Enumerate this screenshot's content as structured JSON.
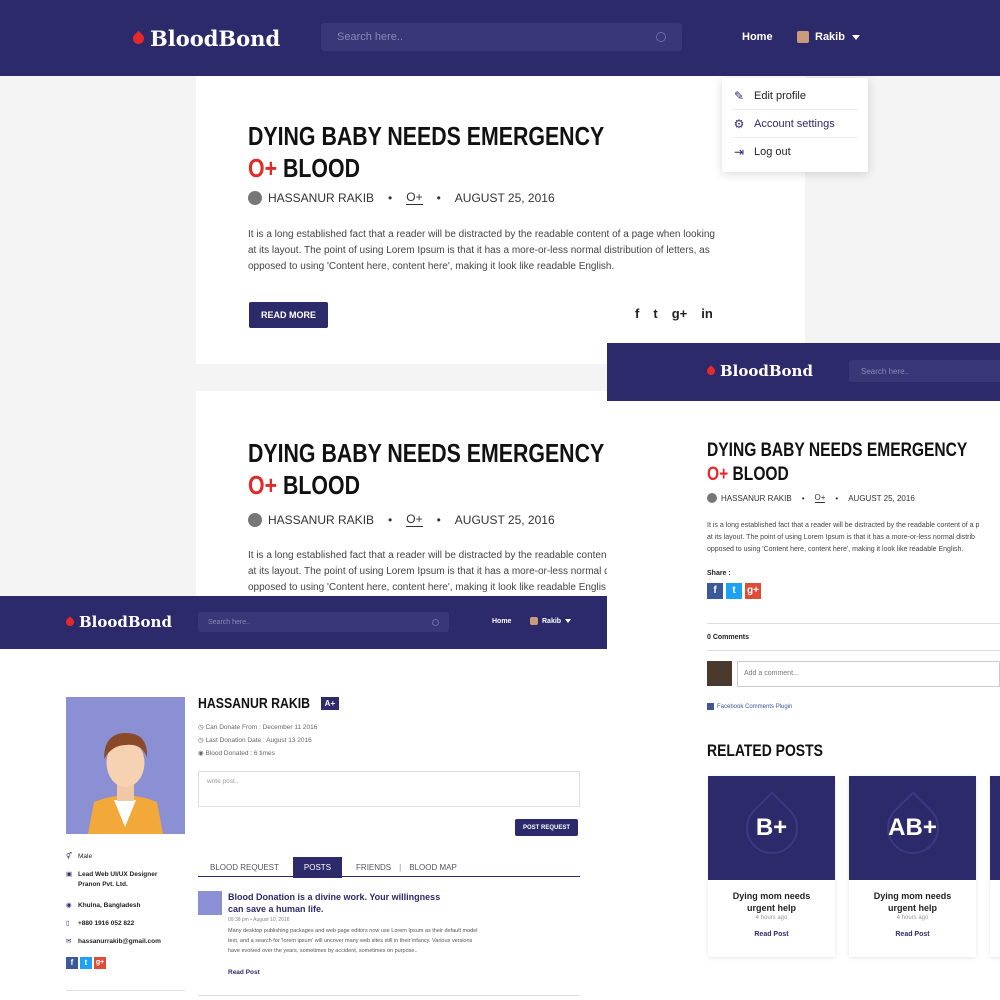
{
  "brand": {
    "name": "BloodBond"
  },
  "search": {
    "placeholder": "Search here.."
  },
  "nav": {
    "home": "Home",
    "user": "Rakib"
  },
  "dropdown": {
    "items": [
      {
        "label": "Edit profile",
        "icon": "edit-user-icon"
      },
      {
        "label": "Account settings",
        "icon": "settings-icon"
      },
      {
        "label": "Log out",
        "icon": "logout-icon"
      }
    ]
  },
  "post": {
    "title_line1": "DYING BABY NEEDS EMERGENCY",
    "blood_group": "O+",
    "title_line2_suffix": "BLOOD",
    "author": "HASSANUR RAKIB",
    "group_meta": "O+",
    "date": "AUGUST 25, 2016",
    "body": "It is a long established fact that a reader will be distracted by the readable content of a page when looking at its layout. The point of using Lorem Ipsum is that it has a more-or-less normal distribution of letters, as opposed to using 'Content here, content here', making it look like readable English.",
    "read_more": "READ MORE",
    "social": [
      "f",
      "t",
      "g+",
      "in"
    ]
  },
  "post2": {
    "body_line1": "It is a long established fact that a reader will be distracted by the readable conten",
    "body_line2": "at its layout. The point of using Lorem Ipsum is that it has a more-or-less normal d",
    "body_line3": "opposed to using 'Content here, content here', making it look like readable Englis"
  },
  "detail": {
    "body_line1": "It is a long established fact that a reader will be distracted by the readable content of a p",
    "body_line2": "at its layout. The point of using Lorem Ipsum is that it has a more-or-less normal distrib",
    "body_line3": "opposed to using 'Content here, content here', making it look like readable English.",
    "share_label": "Share :",
    "comments_count": "0 Comments",
    "comment_placeholder": "Add a comment...",
    "plugin_label": "Facebook Comments Plugin",
    "related_title": "RELATED POSTS",
    "related": [
      {
        "group": "B+",
        "title": "Dying mom needs urgent help",
        "time": "4 hours ago",
        "link": "Read Post"
      },
      {
        "group": "AB+",
        "title": "Dying mom needs urgent help",
        "time": "4 hours ago",
        "link": "Read Post"
      }
    ]
  },
  "profile": {
    "name": "HASSANUR RAKIB",
    "blood_group": "A+",
    "can_donate_label": "Can Donate From :",
    "can_donate_value": "December 11 2016",
    "last_donation_label": "Last Donation Date :",
    "last_donation_value": "August 13 2016",
    "donated_label": "Blood Donated :",
    "donated_value": "6 times",
    "post_placeholder": "write post..",
    "post_request": "POST REQUEST",
    "tabs": [
      "BLOOD REQUEST",
      "POSTS",
      "FRIENDS",
      "BLOOD MAP"
    ],
    "gender": "Male",
    "job_line1": "Lead Web UI/UX Designer",
    "job_line2": "Pranon Pvt. Ltd.",
    "location": "Khulna, Bangladesh",
    "phone": "+880 1916 052 822",
    "email": "hassanurrakib@gmail.com",
    "feed_title_line1": "Blood Donation is a divine work. Your willingness",
    "feed_title_line2": "can save a human life.",
    "feed_time": "09:38 pm",
    "feed_date": "August 10, 2016",
    "feed_body_line1": "Many desktop publishing packages and web page editors now use Lorem Ipsum as their default model",
    "feed_body_line2": "text, and a search for 'lorem ipsum' will uncover many web sites still in their infancy. Various versions",
    "feed_body_line3": "have evolved over the years, sometimes by accident, sometimes on purpose..",
    "feed_link": "Read Post"
  }
}
